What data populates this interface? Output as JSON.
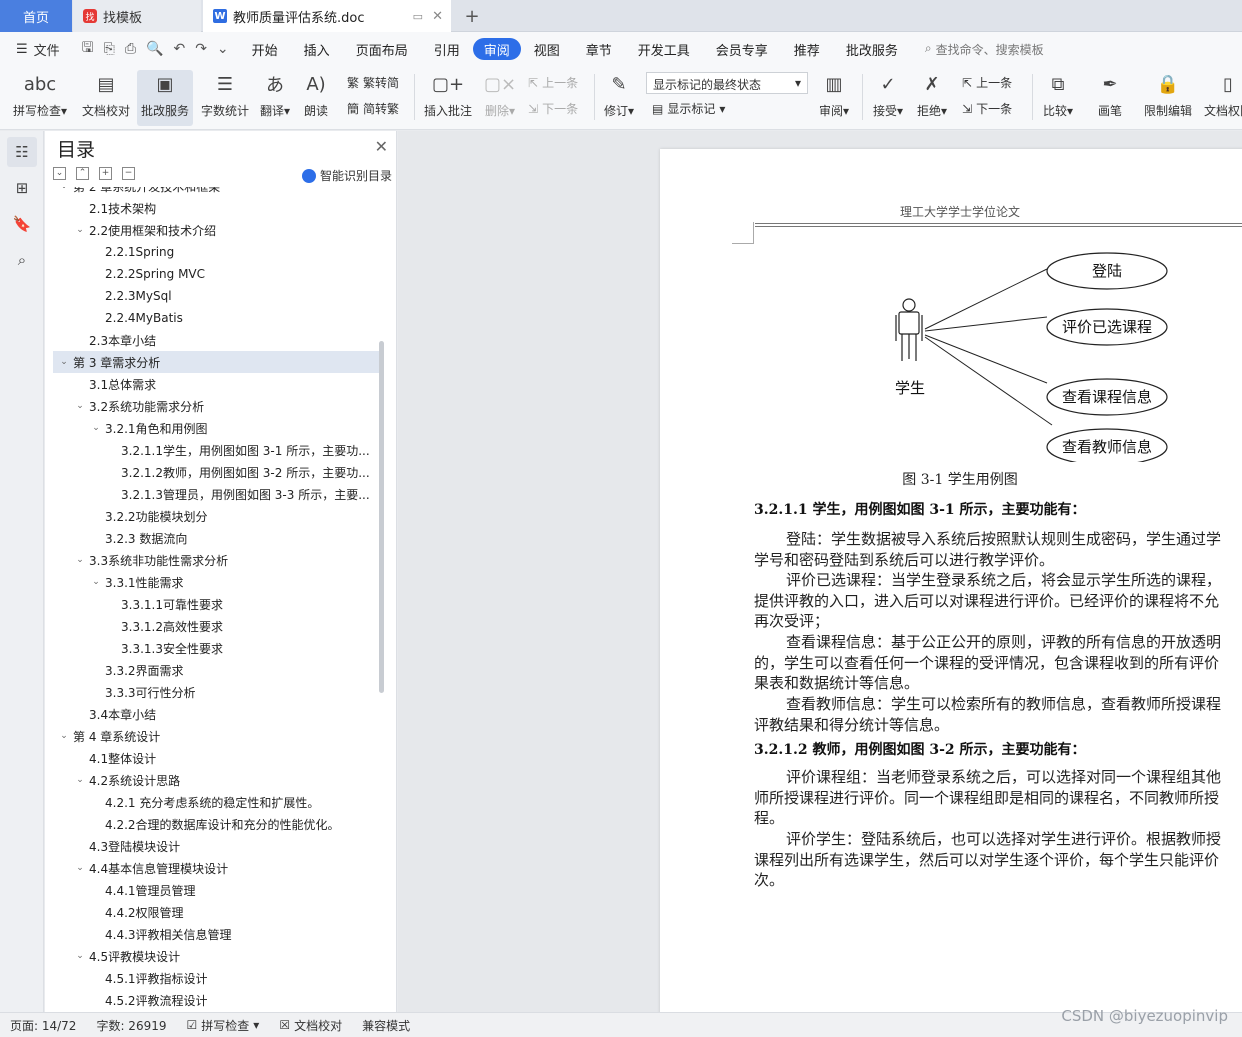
{
  "tabs": {
    "home": "首页",
    "template": "找模板",
    "doc": "教师质量评估系统.doc",
    "plus": "+"
  },
  "menu": {
    "file": "文件",
    "items": [
      "开始",
      "插入",
      "页面布局",
      "引用",
      "审阅",
      "视图",
      "章节",
      "开发工具",
      "会员专享",
      "推荐",
      "批改服务"
    ],
    "active": "审阅",
    "search": "查找命令、搜索模板"
  },
  "ribbon": {
    "spell": "拼写检查",
    "proof": "文档校对",
    "grading": "批改服务",
    "wordcount": "字数统计",
    "translate": "翻译",
    "read": "朗读",
    "trad": "繁转简",
    "simp": "简转繁",
    "insert_comment": "插入批注",
    "delete": "删除",
    "prev": "上一条",
    "next": "下一条",
    "revise": "修订",
    "markup_state": "显示标记的最终状态",
    "show_markup": "显示标记",
    "review": "审阅",
    "accept": "接受",
    "reject": "拒绝",
    "prev2": "上一条",
    "next2": "下一条",
    "compare": "比较",
    "pen": "画笔",
    "restrict": "限制编辑",
    "doc_perm": "文档权限"
  },
  "toc": {
    "title": "目录",
    "smart": "智能识别目录",
    "items": [
      {
        "text": "第 2 章系统开发技术和框架",
        "level": 1,
        "toggle": "v"
      },
      {
        "text": "2.1技术架构",
        "level": 2,
        "toggle": ""
      },
      {
        "text": "2.2使用框架和技术介绍",
        "level": 2,
        "toggle": "v"
      },
      {
        "text": "2.2.1Spring",
        "level": 3,
        "toggle": ""
      },
      {
        "text": "2.2.2Spring MVC",
        "level": 3,
        "toggle": ""
      },
      {
        "text": "2.2.3MySql",
        "level": 3,
        "toggle": ""
      },
      {
        "text": "2.2.4MyBatis",
        "level": 3,
        "toggle": ""
      },
      {
        "text": "2.3本章小结",
        "level": 2,
        "toggle": ""
      },
      {
        "text": "第 3 章需求分析",
        "level": 1,
        "toggle": "v",
        "selected": true
      },
      {
        "text": "3.1总体需求",
        "level": 2,
        "toggle": ""
      },
      {
        "text": "3.2系统功能需求分析",
        "level": 2,
        "toggle": "v"
      },
      {
        "text": "3.2.1角色和用例图",
        "level": 3,
        "toggle": "v"
      },
      {
        "text": "3.2.1.1学生，用例图如图 3-1 所示，主要功...",
        "level": 4,
        "toggle": ""
      },
      {
        "text": "3.2.1.2教师，用例图如图 3-2 所示，主要功...",
        "level": 4,
        "toggle": ""
      },
      {
        "text": "3.2.1.3管理员，用例图如图 3-3 所示，主要...",
        "level": 4,
        "toggle": ""
      },
      {
        "text": "3.2.2功能模块划分",
        "level": 3,
        "toggle": ""
      },
      {
        "text": "3.2.3  数据流向",
        "level": 3,
        "toggle": ""
      },
      {
        "text": "3.3系统非功能性需求分析",
        "level": 2,
        "toggle": "v"
      },
      {
        "text": "3.3.1性能需求",
        "level": 3,
        "toggle": "v"
      },
      {
        "text": "3.3.1.1可靠性要求",
        "level": 4,
        "toggle": ""
      },
      {
        "text": "3.3.1.2高效性要求",
        "level": 4,
        "toggle": ""
      },
      {
        "text": "3.3.1.3安全性要求",
        "level": 4,
        "toggle": ""
      },
      {
        "text": "3.3.2界面需求",
        "level": 3,
        "toggle": ""
      },
      {
        "text": "3.3.3可行性分析",
        "level": 3,
        "toggle": ""
      },
      {
        "text": "3.4本章小结",
        "level": 2,
        "toggle": ""
      },
      {
        "text": "第 4 章系统设计",
        "level": 1,
        "toggle": "v"
      },
      {
        "text": "4.1整体设计",
        "level": 2,
        "toggle": ""
      },
      {
        "text": "4.2系统设计思路",
        "level": 2,
        "toggle": "v"
      },
      {
        "text": "4.2.1  充分考虑系统的稳定性和扩展性。",
        "level": 3,
        "toggle": ""
      },
      {
        "text": "4.2.2合理的数据库设计和充分的性能优化。",
        "level": 3,
        "toggle": ""
      },
      {
        "text": "4.3登陆模块设计",
        "level": 2,
        "toggle": ""
      },
      {
        "text": "4.4基本信息管理模块设计",
        "level": 2,
        "toggle": "v"
      },
      {
        "text": "4.4.1管理员管理",
        "level": 3,
        "toggle": ""
      },
      {
        "text": "4.4.2权限管理",
        "level": 3,
        "toggle": ""
      },
      {
        "text": "4.4.3评教相关信息管理",
        "level": 3,
        "toggle": ""
      },
      {
        "text": "4.5评教模块设计",
        "level": 2,
        "toggle": "v"
      },
      {
        "text": "4.5.1评教指标设计",
        "level": 3,
        "toggle": ""
      },
      {
        "text": "4.5.2评教流程设计",
        "level": 3,
        "toggle": ""
      }
    ]
  },
  "page": {
    "header": "理工大学学士学位论文",
    "actor": "学生",
    "usecases": [
      "登陆",
      "评价已选课程",
      "查看课程信息",
      "查看教师信息"
    ],
    "caption": "图 3-1 学生用例图",
    "sec1": "3.2.1.1  学生，用例图如图 3-1 所示，主要功能有：",
    "p1": [
      "登陆：学生数据被导入系统后按照默认规则生成密码，学生通过学",
      "学号和密码登陆到系统后可以进行教学评价。"
    ],
    "p2": [
      "评价已选课程：当学生登录系统之后，将会显示学生所选的课程，",
      "提供评教的入口，进入后可以对课程进行评价。已经评价的课程将不允",
      "再次受评；"
    ],
    "p3": [
      "查看课程信息：基于公正公开的原则，评教的所有信息的开放透明",
      "的，学生可以查看任何一个课程的受评情况，包含课程收到的所有评价",
      "果表和数据统计等信息。"
    ],
    "p4": [
      "查看教师信息：学生可以检索所有的教师信息，查看教师所授课程",
      "评教结果和得分统计等信息。"
    ],
    "sec2": "3.2.1.2  教师，用例图如图 3-2 所示，主要功能有：",
    "p5": [
      "评价课程组：当老师登录系统之后，可以选择对同一个课程组其他",
      "师所授课程进行评价。同一个课程组即是相同的课程名，不同教师所授",
      "程。"
    ],
    "p6": [
      "评价学生：登陆系统后，也可以选择对学生进行评价。根据教师授",
      "课程列出所有选课学生，然后可以对学生逐个评价，每个学生只能评价",
      "次。"
    ]
  },
  "status": {
    "page": "页面: 14/72",
    "words": "字数: 26919",
    "spell": "拼写检查",
    "proof": "文档校对",
    "compat": "兼容模式"
  },
  "watermark": "CSDN @biyezuopinvip"
}
